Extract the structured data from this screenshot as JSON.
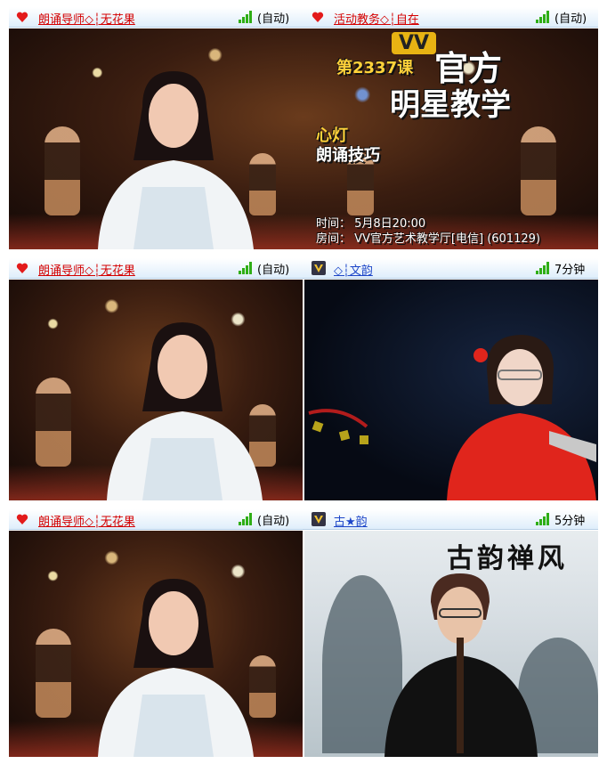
{
  "rows": [
    {
      "left": {
        "name": "朗诵导师◇┆无花果",
        "status": "(自动)",
        "icon": "heart-icon"
      },
      "right": {
        "name": "活动教务◇┆自在",
        "status": "(自动)",
        "icon": "heart-icon"
      },
      "banner": {
        "vv": "VV",
        "lesson": "第2337课",
        "title_line1": "官方",
        "title_line2": "明星教学",
        "topic_line1": "心灯",
        "topic_line2": "朗诵技巧",
        "time": "时间：  5月8日20:00",
        "room": "房间：  VV官方艺术教学厅[电信] (601129)"
      }
    },
    {
      "left": {
        "name": "朗诵导师◇┆无花果",
        "status": "(自动)",
        "icon": "heart-icon"
      },
      "right": {
        "name": "◇┆文韵",
        "status": "7分钟",
        "icon": "vip-badge-icon"
      }
    },
    {
      "left": {
        "name": "朗诵导师◇┆无花果",
        "status": "(自动)",
        "icon": "heart-icon"
      },
      "right": {
        "name": "古★韵",
        "status": "5分钟",
        "icon": "vip-badge-icon"
      },
      "calligraphy": "古韵禅风"
    }
  ],
  "colors": {
    "name_red": "#d40000",
    "name_blue": "#1d46c8",
    "signal_green": "#2fae16",
    "bar_bg": "#dfeefb"
  }
}
